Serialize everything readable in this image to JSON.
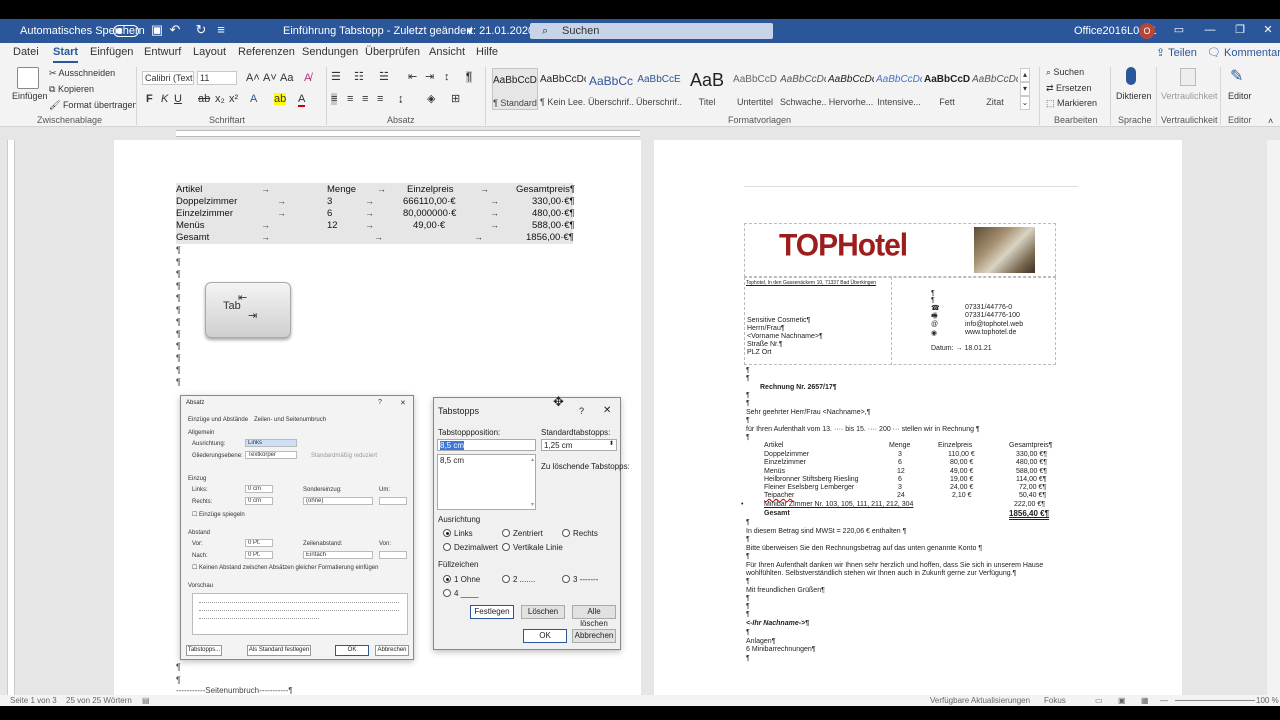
{
  "titlebar": {
    "autosave_label": "Automatisches Speichern",
    "doc_title": "Einführung Tabstopp  -  Zuletzt geändert: 21.01.2020",
    "search_placeholder": "Suchen",
    "user": "Office2016L0011",
    "avatar": "O"
  },
  "tabs": [
    "Datei",
    "Start",
    "Einfügen",
    "Entwurf",
    "Layout",
    "Referenzen",
    "Sendungen",
    "Überprüfen",
    "Ansicht",
    "Hilfe"
  ],
  "tabs_right": {
    "share": "Teilen",
    "comments": "Kommentare"
  },
  "ribbon": {
    "clipboard": {
      "paste": "Einfügen",
      "cut": "Ausschneiden",
      "copy": "Kopieren",
      "format": "Format übertragen",
      "group": "Zwischenablage"
    },
    "font": {
      "name": "Calibri (Textk",
      "size": "11",
      "group": "Schriftart"
    },
    "paragraph": {
      "group": "Absatz"
    },
    "styles": {
      "group": "Formatvorlagen",
      "items": [
        {
          "preview": "AaBbCcDc",
          "name": "¶ Standard"
        },
        {
          "preview": "AaBbCcDc",
          "name": "¶ Kein Lee..."
        },
        {
          "preview": "AaBbCc",
          "name": "Überschrif..."
        },
        {
          "preview": "AaBbCcE",
          "name": "Überschrif..."
        },
        {
          "preview": "AaB",
          "name": "Titel"
        },
        {
          "preview": "AaBbCcD",
          "name": "Untertitel"
        },
        {
          "preview": "AaBbCcDc",
          "name": "Schwache..."
        },
        {
          "preview": "AaBbCcDc",
          "name": "Hervorhe..."
        },
        {
          "preview": "AaBbCcDc",
          "name": "Intensive..."
        },
        {
          "preview": "AaBbCcDc",
          "name": "Fett"
        },
        {
          "preview": "AaBbCcDc",
          "name": "Zitat"
        }
      ]
    },
    "editing": {
      "find": "Suchen",
      "replace": "Ersetzen",
      "select": "Markieren",
      "group": "Bearbeiten"
    },
    "voice": {
      "dictate": "Diktieren",
      "group": "Sprache"
    },
    "sensitivity": {
      "label": "Vertraulichkeit",
      "group": "Vertraulichkeit"
    },
    "editor": {
      "label": "Editor",
      "group": "Editor"
    }
  },
  "page1": {
    "table": {
      "header": [
        "Artikel",
        "Menge",
        "Einzelpreis",
        "Gesamtpreis¶"
      ],
      "rows": [
        [
          "Doppelzimmer",
          "3",
          "666110,00·€",
          "330,00·€¶"
        ],
        [
          "Einzelzimmer",
          "6",
          "80,000000·€",
          "480,00·€¶"
        ],
        [
          "Menüs",
          "12",
          "49,00·€",
          "588,00·€¶"
        ],
        [
          "Gesamt",
          "",
          "",
          "1856,00·€¶"
        ]
      ]
    },
    "pilcrow": "¶",
    "tabkey_label": "Tab",
    "section_break": "-----------Seitenumbruch-----------¶"
  },
  "absatz_dialog": {
    "title": "Absatz",
    "tabs": [
      "Einzüge und Abstände",
      "Zeilen- und Seitenumbruch"
    ],
    "allgemein": "Allgemein",
    "ausrichtung": "Ausrichtung:",
    "ausrichtung_val": "Links",
    "gliederung": "Gliederungsebene:",
    "gliederung_val": "Textkörper",
    "standard_reduziert": "Standardmäßig reduziert",
    "einzug": "Einzug",
    "links": "Links:",
    "links_val": "0 cm",
    "rechts": "Rechts:",
    "rechts_val": "0 cm",
    "sondereinzug": "Sondereinzug:",
    "sondereinzug_val": "(ohne)",
    "um": "Um:",
    "einzuege_spiegeln": "Einzüge spiegeln",
    "abstand": "Abstand",
    "vor": "Vor:",
    "vor_val": "0 Pt.",
    "nach": "Nach:",
    "nach_val": "0 Pt.",
    "zeilenabstand": "Zeilenabstand:",
    "zeilenabstand_val": "Einfach",
    "von": "Von:",
    "kein_abstand": "Keinen Abstand zwischen Absätzen gleicher Formatierung einfügen",
    "vorschau": "Vorschau",
    "btn_tabstopps": "Tabstopps...",
    "btn_standard": "Als Standard festlegen",
    "btn_ok": "OK",
    "btn_abbrechen": "Abbrechen"
  },
  "tab_dialog": {
    "title": "Tabstopps",
    "help": "?",
    "position_label": "Tabstoppposition:",
    "position_value": "8,5 cm",
    "list": [
      "8,5 cm"
    ],
    "standard_label": "Standardtabstopps:",
    "standard_value": "1,25 cm",
    "delete_label": "Zu löschende Tabstopps:",
    "ausrichtung": "Ausrichtung",
    "align_options": [
      "Links",
      "Zentriert",
      "Rechts",
      "Dezimalwert",
      "Vertikale Linie"
    ],
    "fuell": "Füllzeichen",
    "fill_options": [
      "1 Ohne",
      "2 .......",
      "3 -------",
      "4 ____"
    ],
    "btn_set": "Festlegen",
    "btn_delete": "Löschen",
    "btn_delete_all": "Alle löschen",
    "btn_ok": "OK",
    "btn_cancel": "Abbrechen"
  },
  "page2": {
    "logo": "TOPHotel",
    "sender_line": "Tophotel, In den Gassenäckern 10, 71337 Bad Überkingen",
    "address": [
      "Sensitive Cosmetic¶",
      "Herrn/Frau¶",
      "<Vorname Nachname>¶",
      "Straße Nr.¶",
      "PLZ Ort"
    ],
    "contact": [
      {
        "sym": "☎",
        "text": "07331/44776-0"
      },
      {
        "sym": "🖷",
        "text": "07331/44776-100"
      },
      {
        "sym": "@",
        "text": "info@tophotel.web"
      },
      {
        "sym": "◉",
        "text": "www.tophotel.de"
      }
    ],
    "datum": "Datum:  →  18.01.21",
    "invoice_no": "Rechnung Nr. 2657/17¶",
    "salutation": "Sehr geehrter Herr/Frau <Nachname>,¶",
    "stay_line": "für Ihren Aufenthalt vom 13. ···· bis 15. ···· 200 ··· stellen wir in Rechnung ¶",
    "items_header": [
      "Artikel",
      "Menge",
      "Einzelpreis",
      "Gesamtpreis¶"
    ],
    "items": [
      [
        "Doppelzimmer",
        "3",
        "110,00 €",
        "330,00 €¶"
      ],
      [
        "Einzelzimmer",
        "6",
        "80,00 €",
        "480,00 €¶"
      ],
      [
        "Menüs",
        "12",
        "49,00 €",
        "588,00 €¶"
      ],
      [
        "Heilbronner Stiftsberg Riesling",
        "6",
        "19,00 €",
        "114,00 €¶"
      ],
      [
        "Fleiner Eselsberg Lemberger",
        "3",
        "24,00 €",
        "72,00 €¶"
      ],
      [
        "Teipacher",
        "24",
        "2,10 €",
        "50,40 €¶"
      ],
      [
        "Minibar Zimmer Nr. 103, 105, 111, 211, 212, 304",
        "",
        "",
        "222,00 €¶"
      ]
    ],
    "total_label": "Gesamt",
    "total_value": "1856,40 €¶",
    "mwst": "In diesem Betrag sind MWSt = 220,06 € enthalten ¶",
    "ueberweisen": "Bitte überweisen Sie den Rechnungsbetrag auf das unten genannte Konto ¶",
    "dank1": "Für Ihren Aufenthalt danken wir Ihnen sehr herzlich und hoffen, dass Sie sich in unserem Hause",
    "dank2": "wohlfühlten. Selbstverständlich stehen wir Ihnen auch in Zukunft gerne zur Verfügung.¶",
    "gruss": "Mit freundlichen Grüßen¶",
    "name": "<-Ihr Nachname->¶",
    "anlagen": "Anlagen¶",
    "minibar": "6 Minibarrechnungen¶"
  },
  "status": {
    "page": "Seite 1 von 3",
    "words": "25 von 25 Wörtern",
    "updates": "Verfügbare Aktualisierungen",
    "focus": "Fokus",
    "zoom": "100 %"
  }
}
